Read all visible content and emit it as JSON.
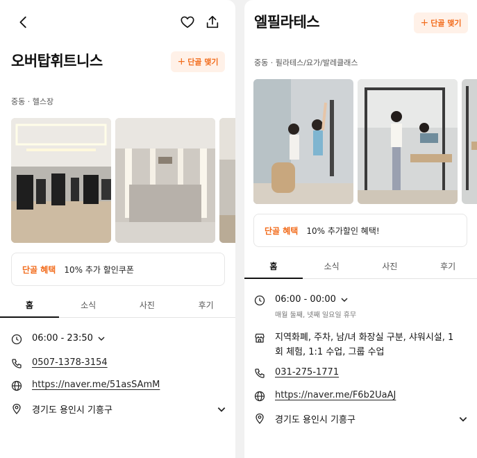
{
  "left": {
    "title": "오버탑휘트니스",
    "regular_button": {
      "plus": "+",
      "label": "단골 맺기"
    },
    "category": "중동 · 헬스장",
    "benefit": {
      "label": "단골 혜택",
      "text": "10% 추가 할인쿠폰"
    },
    "tabs": [
      {
        "label": "홈",
        "active": true
      },
      {
        "label": "소식"
      },
      {
        "label": "사진"
      },
      {
        "label": "후기"
      }
    ],
    "hours": "06:00 - 23:50",
    "phone": "0507-1378-3154",
    "url": "https://naver.me/51asSAmM",
    "address": "경기도 용인시 기흥구"
  },
  "right": {
    "title": "엘필라테스",
    "regular_button": {
      "plus": "+",
      "label": "단골 맺기"
    },
    "category": "중동 · 필라테스/요가/발레클래스",
    "benefit": {
      "label": "단골 혜택",
      "text": "10% 추가할인 혜택!"
    },
    "tabs": [
      {
        "label": "홈",
        "active": true
      },
      {
        "label": "소식"
      },
      {
        "label": "사진"
      },
      {
        "label": "후기"
      }
    ],
    "hours": "06:00 - 00:00",
    "hours_note": "매월 둘째, 넷째 일요일 휴무",
    "amenities_line1": "지역화폐, 주차, 남/녀 화장실 구분, 샤워시설, 1",
    "amenities_line2": "회 체험, 1:1 수업, 그룹 수업",
    "phone": "031-275-1771",
    "url": "https://naver.me/F6b2UaAJ",
    "address": "경기도 용인시 기흥구"
  },
  "colors": {
    "accent": "#f26c1c",
    "accent_bg": "#fff1e8"
  }
}
